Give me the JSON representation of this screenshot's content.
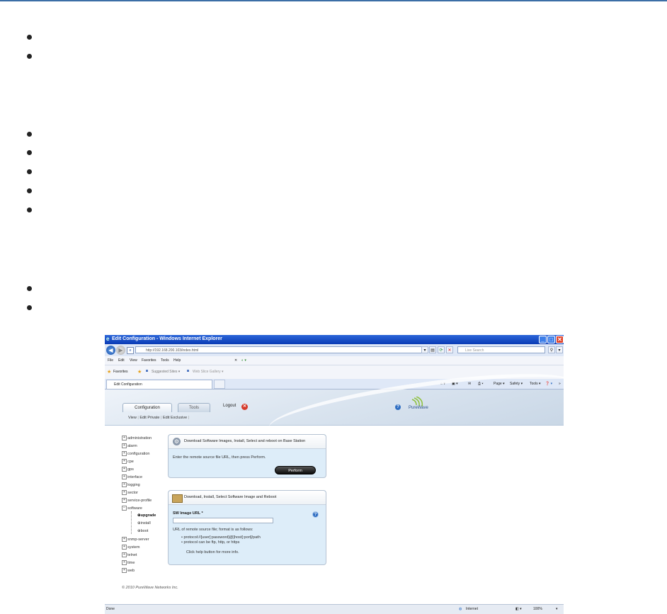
{
  "bullets_group1": 2,
  "bullets_group2": 5,
  "bullets_group3": 2,
  "window": {
    "title": "Edit Configuration - Windows Internet Explorer",
    "address": "http://192.168.200.103/index.html",
    "search_placeholder": "Live Search"
  },
  "menu": [
    "File",
    "Edit",
    "View",
    "Favorites",
    "Tools",
    "Help"
  ],
  "favorites": {
    "label": "Favorites",
    "suggested": "Suggested Sites ▾",
    "gallery": "Web Slice Gallery ▾"
  },
  "browser_tab": "Edit Configuration",
  "command_bar": {
    "page": "Page ▾",
    "safety": "Safety ▾",
    "tools": "Tools ▾"
  },
  "app": {
    "tab_configuration": "Configuration",
    "tab_tools": "Tools",
    "logout": "Logout",
    "brand": "PureWave",
    "subnav": [
      "View",
      "Edit Private",
      "Edit Exclusive"
    ]
  },
  "tree": [
    "administration",
    "alarm",
    "configuration",
    "cpe",
    "gps",
    "interface",
    "logging",
    "sector",
    "service-profile",
    "software",
    "snmp-server",
    "system",
    "telnet",
    "time",
    "web"
  ],
  "tree_software_children": [
    "upgrade",
    "install",
    "boot"
  ],
  "panel1": {
    "title": "Download Software Images, Install, Select and reboot on Base Station",
    "text": "Enter the remote source file URL, then press Perform.",
    "button": "Perform"
  },
  "panel2": {
    "title": "Download, Install, Select Software Image and Reboot",
    "field_label": "SW Image URL *",
    "desc": "URL of remote source file; format is as follows:",
    "format1": "• protocol://[user[:password]@]host[:port]/path",
    "format2": "• protocol can be ftp, http, or https",
    "help_text": "Click help button for more info."
  },
  "copyright": "© 2010 PureWave Networks Inc.",
  "status": {
    "left": "Done",
    "zone": "Internet",
    "zoom": "100%"
  }
}
